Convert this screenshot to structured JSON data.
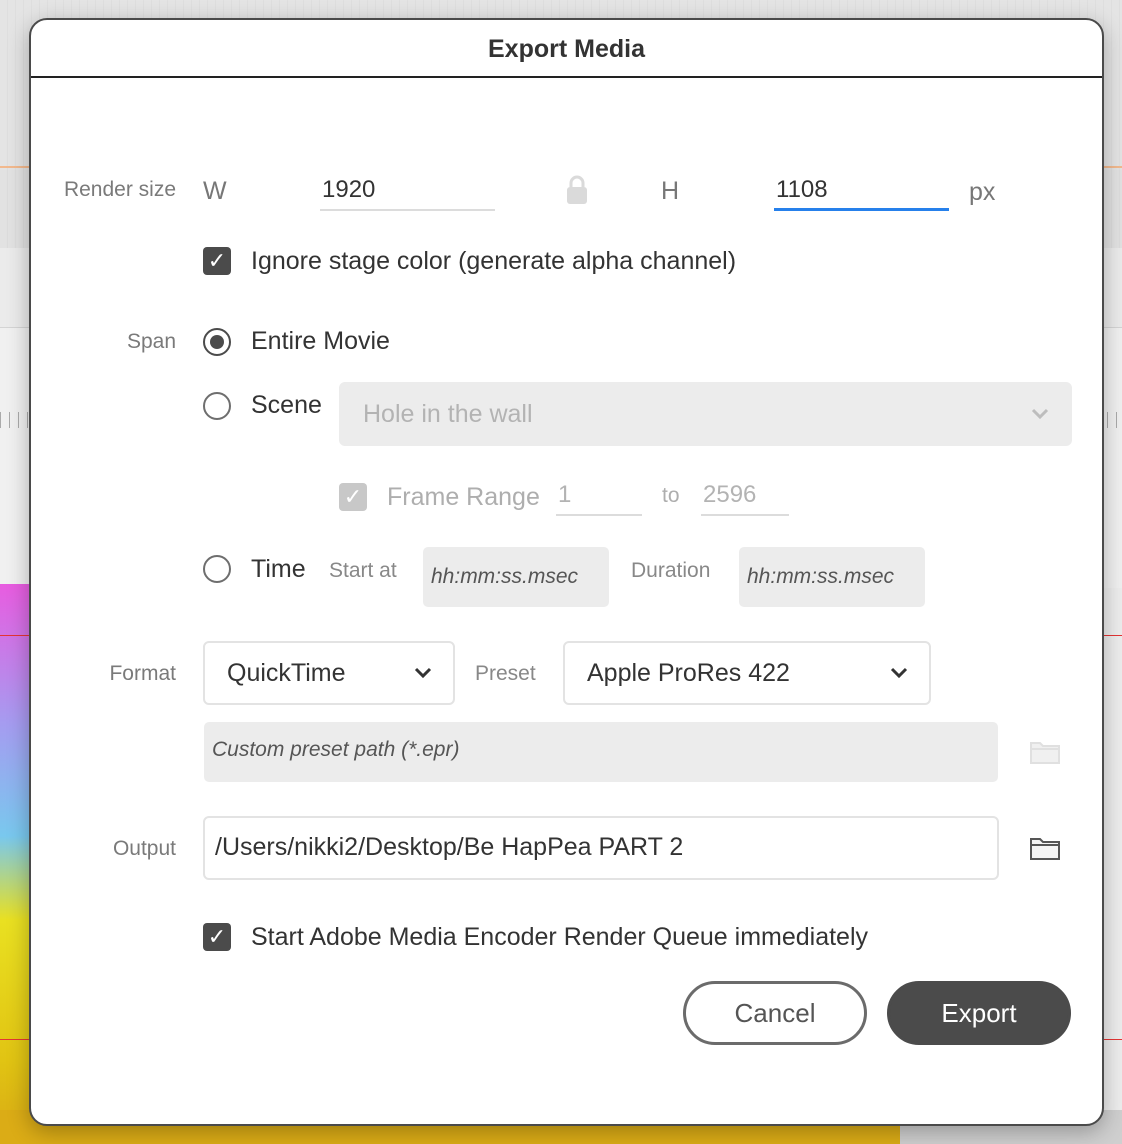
{
  "dialog": {
    "title": "Export Media"
  },
  "render_size": {
    "label": "Render size",
    "w_label": "W",
    "width": "1920",
    "h_label": "H",
    "height": "1108",
    "unit": "px",
    "lock_icon": "lock-icon"
  },
  "ignore_stage": {
    "label": "Ignore stage color (generate alpha channel)",
    "checked": true
  },
  "span": {
    "label": "Span",
    "entire_movie": "Entire Movie",
    "scene": "Scene",
    "scene_value": "Hole in the wall",
    "frame_range_label": "Frame Range",
    "frame_from": "1",
    "to_label": "to",
    "frame_to": "2596",
    "time": "Time",
    "start_at_label": "Start at",
    "start_placeholder": "hh:mm:ss.msec",
    "duration_label": "Duration",
    "duration_placeholder": "hh:mm:ss.msec",
    "selected": "entire_movie"
  },
  "format": {
    "label": "Format",
    "value": "QuickTime",
    "preset_label": "Preset",
    "preset_value": "Apple ProRes 422",
    "custom_preset_placeholder": "Custom preset path (*.epr)"
  },
  "output": {
    "label": "Output",
    "path": "/Users/nikki2/Desktop/Be HapPea PART 2"
  },
  "start_queue": {
    "label": "Start Adobe Media Encoder Render Queue immediately",
    "checked": true
  },
  "buttons": {
    "cancel": "Cancel",
    "export": "Export"
  },
  "colors": {
    "accent": "#2680eb",
    "primary_button": "#4b4b4b",
    "dialog_bg": "#ffffff"
  }
}
